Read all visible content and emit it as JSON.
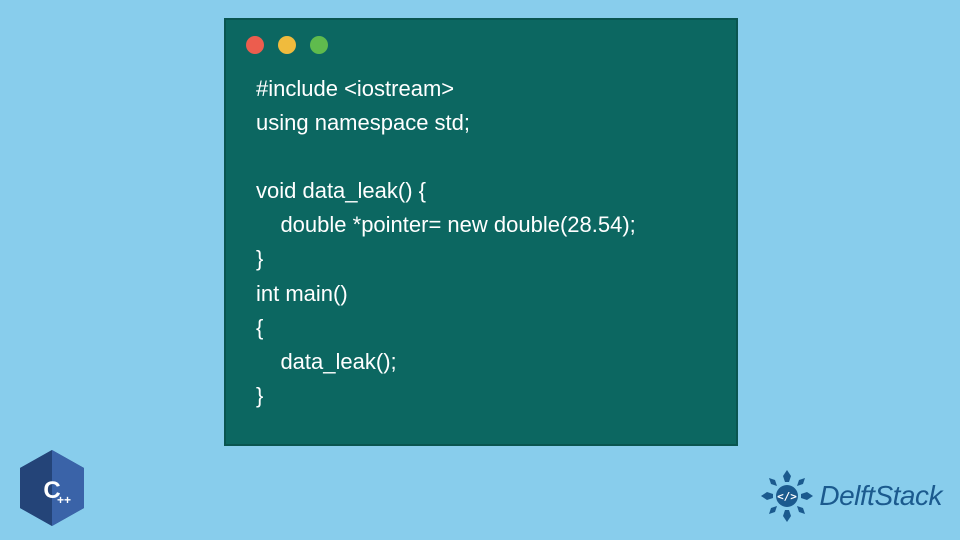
{
  "code": {
    "lines": [
      "#include <iostream>",
      "using namespace std;",
      "",
      "void data_leak() {",
      "    double *pointer= new double(28.54);",
      "}",
      "int main()",
      "{",
      "    data_leak();",
      "}"
    ]
  },
  "cpp_badge": {
    "label": "C++"
  },
  "delft": {
    "brand": "DelftStack"
  },
  "colors": {
    "page_bg": "#88cdec",
    "window_bg": "#0c6761",
    "code_text": "#ffffff",
    "dot_red": "#ec5d4e",
    "dot_yellow": "#f0bb3d",
    "dot_green": "#5fbb4d",
    "cpp_blue": "#2c4f8c",
    "delft_blue": "#1b5a8e"
  }
}
